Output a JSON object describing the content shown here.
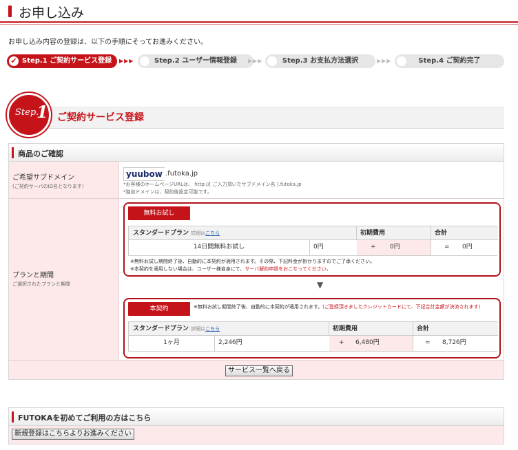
{
  "header": {
    "title": "お申し込み"
  },
  "intro": "お申し込み内容の登録は、以下の手順にそってお進みください。",
  "steps": [
    {
      "label": "Step.1 ご契約サービス登録"
    },
    {
      "label": "Step.2 ユーザー情報登録"
    },
    {
      "label": "Step.3 お支払方法選択"
    },
    {
      "label": "Step.4 ご契約完了"
    }
  ],
  "step_badge": {
    "text": "Step.",
    "num": "1"
  },
  "step_heading": "ご契約サービス登録",
  "product": {
    "title": "商品のご確認",
    "domain": {
      "label": "ご希望サブドメイン",
      "sub": "(ご契約サーバのID名となります)",
      "value": "yuubow",
      "suffix": ".futoka.jp",
      "note1": "*お客様のホームページURLは、 http://[ ご入力頂いたサブドメイン名 ].futoka.jp",
      "note2": "*独自ドメインは、契約後設定可能です。"
    },
    "plan": {
      "label": "プランと期間",
      "sub": "ご選択されたプランと期間",
      "trial": {
        "badge": "無料お試し",
        "plan_header": "スタンダードプラン",
        "detail_prefix": "詳細は",
        "detail_link": "こちら",
        "initial_header": "初期費用",
        "total_header": "合計",
        "period": "14日間無料お試し",
        "price": "0円",
        "plus": "+",
        "initial": "0円",
        "eq": "=",
        "total": "0円",
        "note1": "※無料お試し期間終了後、自動的に本契約が適用されます。その際、下記料金が掛かりますのでご了承ください。",
        "note2_a": "※本契約を適用しない場合は、ユーザー様自身にて、",
        "note2_b": "サーバ解約申請をおこなってください。"
      },
      "arrow": "▼",
      "main": {
        "badge": "本契約",
        "note_a": "※無料お試し期間終了後、自動的に本契約が適用されます。",
        "note_b": "(ご登録頂きましたクレジットカードにて、下記合計金額が決済されます)",
        "plan_header": "スタンダードプラン",
        "detail_prefix": "詳細は",
        "detail_link": "こちら",
        "initial_header": "初期費用",
        "total_header": "合計",
        "period": "1ヶ月",
        "price": "2,246円",
        "plus": "+",
        "initial": "6,480円",
        "eq": "=",
        "total": "8,726円"
      }
    },
    "back_button": "サービス一覧へ戻る"
  },
  "first_time": {
    "title": "FUTOKAを初めてご利用の方はこちら",
    "button": "新規登録はこちらよりお進みください"
  }
}
